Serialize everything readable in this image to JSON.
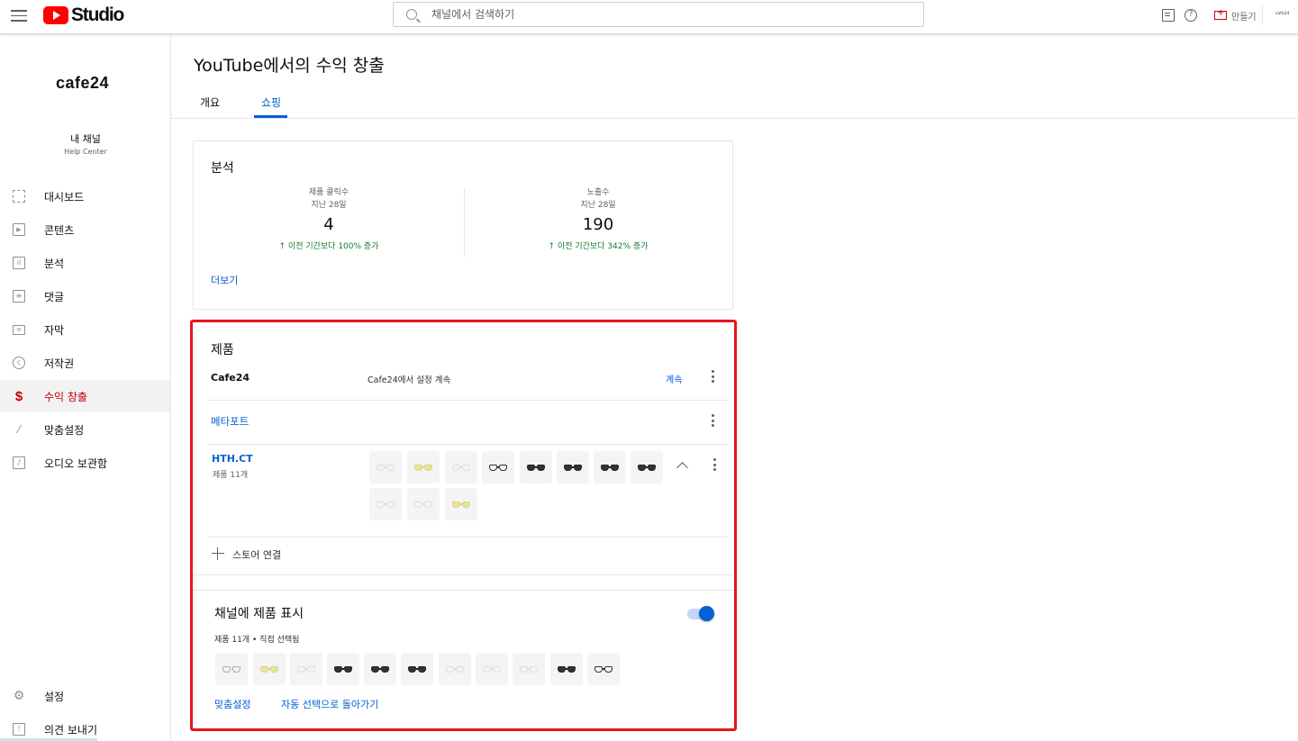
{
  "header": {
    "logo_text": "Studio",
    "search_placeholder": "채널에서 검색하기",
    "help_glyph": "?",
    "create_label": "만들기",
    "account_label": "cafe24"
  },
  "sidebar": {
    "brand": "cafe24",
    "channel_name": "내 채널",
    "channel_sub": "Help Center",
    "items": [
      {
        "label": "대시보드",
        "icon": "dashboard-icon"
      },
      {
        "label": "콘텐츠",
        "icon": "content-icon"
      },
      {
        "label": "분석",
        "icon": "analytics-icon"
      },
      {
        "label": "댓글",
        "icon": "comments-icon"
      },
      {
        "label": "자막",
        "icon": "subtitles-icon"
      },
      {
        "label": "저작권",
        "icon": "copyright-icon"
      },
      {
        "label": "수익 창출",
        "icon": "monetization-icon",
        "active": true
      },
      {
        "label": "맞춤설정",
        "icon": "customization-icon"
      },
      {
        "label": "오디오 보관함",
        "icon": "audio-library-icon"
      }
    ],
    "settings_label": "설정",
    "feedback_label": "의견 보내기"
  },
  "main": {
    "title": "YouTube에서의 수익 창출",
    "tabs": [
      {
        "label": "개요",
        "active": false
      },
      {
        "label": "쇼핑",
        "active": true
      }
    ],
    "analytics": {
      "title": "분석",
      "metrics": [
        {
          "label": "제품 클릭수",
          "period": "지난 28일",
          "value": "4",
          "change": "↑ 이전 기간보다 100% 증가"
        },
        {
          "label": "노출수",
          "period": "지난 28일",
          "value": "190",
          "change": "↑ 이전 기간보다 342% 증가"
        }
      ],
      "more_label": "더보기"
    },
    "products": {
      "title": "제품",
      "stores": [
        {
          "name": "Cafe24",
          "status": "Cafe24에서 설정 계속",
          "action": "계속"
        },
        {
          "name": "메타포트"
        },
        {
          "name": "HTH.CT",
          "count": "제품 11개"
        }
      ],
      "connect_label": "스토어 연결"
    },
    "channel_display": {
      "title": "채널에 제품 표시",
      "meta": "제품 11개 • 직접 선택됨",
      "toggle_on": true,
      "customize_label": "맞춤설정",
      "revert_label": "자동 선택으로 돌아가기"
    }
  },
  "colors": {
    "accent": "#065fd4",
    "brand_red": "#ff0000",
    "highlight_red": "#e8131c",
    "positive_green": "#0f7d32"
  }
}
